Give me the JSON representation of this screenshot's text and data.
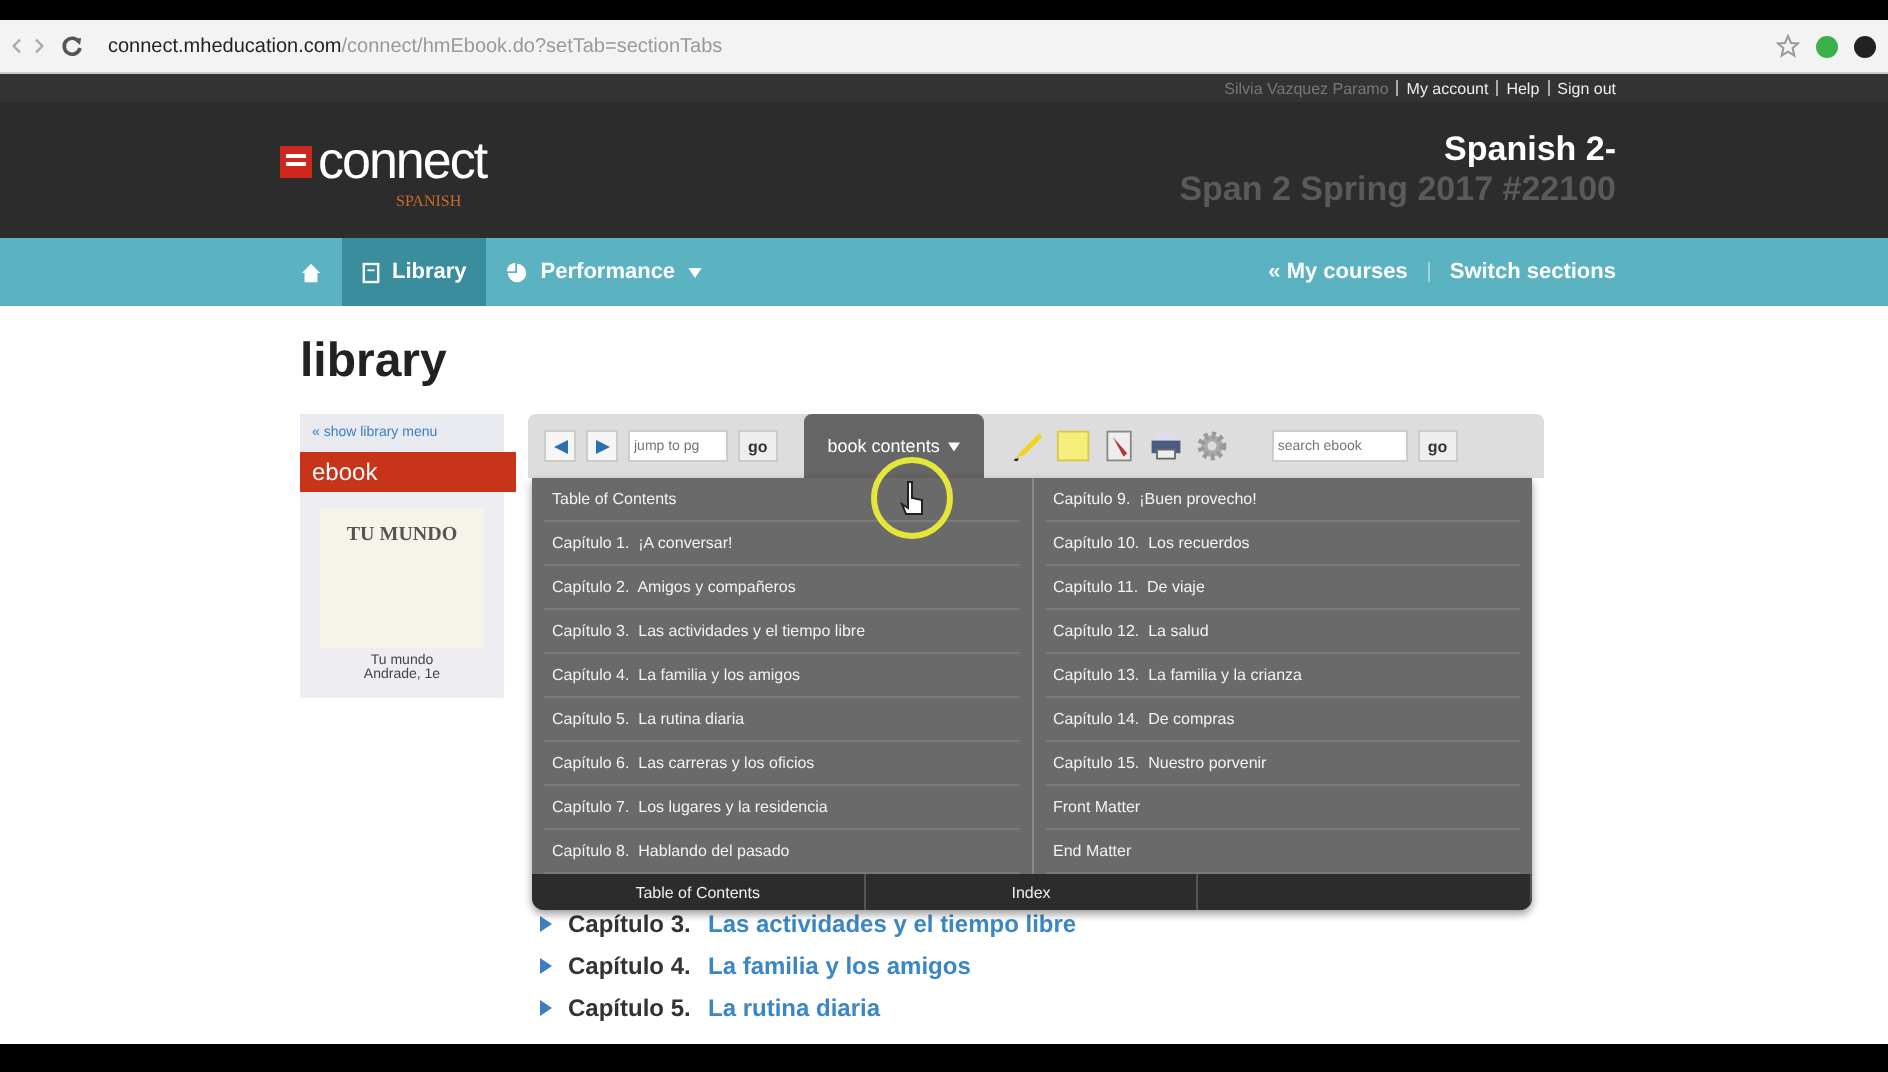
{
  "browser": {
    "url_host": "connect.mheducation.com",
    "url_path": "/connect/hmEbook.do?setTab=sectionTabs"
  },
  "user_bar": {
    "user": "Silvia Vazquez Paramo",
    "links": [
      "My account",
      "Help",
      "Sign out"
    ]
  },
  "header": {
    "logo_text": "connect",
    "logo_sub": "SPANISH",
    "course_title": "Spanish 2-",
    "section": "Span 2 Spring 2017 #22100"
  },
  "nav": {
    "items": [
      {
        "kind": "home",
        "selected": false
      },
      {
        "kind": "library",
        "label": "Library",
        "selected": true
      },
      {
        "kind": "performance",
        "label": "Performance",
        "selected": false
      }
    ],
    "right_links": [
      "« My courses",
      "Switch sections"
    ]
  },
  "page_title": "library",
  "sidebar": {
    "show_menu": "« show library menu",
    "tab": "ebook",
    "book": {
      "cover_title": "TU MUNDO",
      "title": "Tu mundo",
      "author": "Andrade, 1e"
    }
  },
  "toolbar": {
    "jump_placeholder": "jump to pg",
    "go": "go",
    "contents_tab": "book contents",
    "search_placeholder": "search ebook",
    "search_go": "go"
  },
  "menu": {
    "left": [
      "Table of Contents",
      "Capítulo 1.  ¡A conversar!",
      "Capítulo 2.  Amigos y compañeros",
      "Capítulo 3.  Las actividades y el tiempo libre",
      "Capítulo 4.  La familia y los amigos",
      "Capítulo 5.  La rutina diaria",
      "Capítulo 6.  Las carreras y los oficios",
      "Capítulo 7.  Los lugares y la residencia",
      "Capítulo 8.  Hablando del pasado"
    ],
    "right": [
      "Capítulo 9.  ¡Buen provecho!",
      "Capítulo 10.  Los recuerdos",
      "Capítulo 11.  De viaje",
      "Capítulo 12.  La salud",
      "Capítulo 13.  La familia y la crianza",
      "Capítulo 14.  De compras",
      "Capítulo 15.  Nuestro porvenir",
      "Front Matter",
      "End Matter"
    ],
    "footer_tabs": [
      "Table of Contents",
      "Index"
    ]
  },
  "chapters": [
    {
      "number": "Capítulo 3.",
      "title": "Las actividades y el tiempo libre"
    },
    {
      "number": "Capítulo 4.",
      "title": "La familia y los amigos"
    },
    {
      "number": "Capítulo 5.",
      "title": "La rutina diaria"
    }
  ]
}
